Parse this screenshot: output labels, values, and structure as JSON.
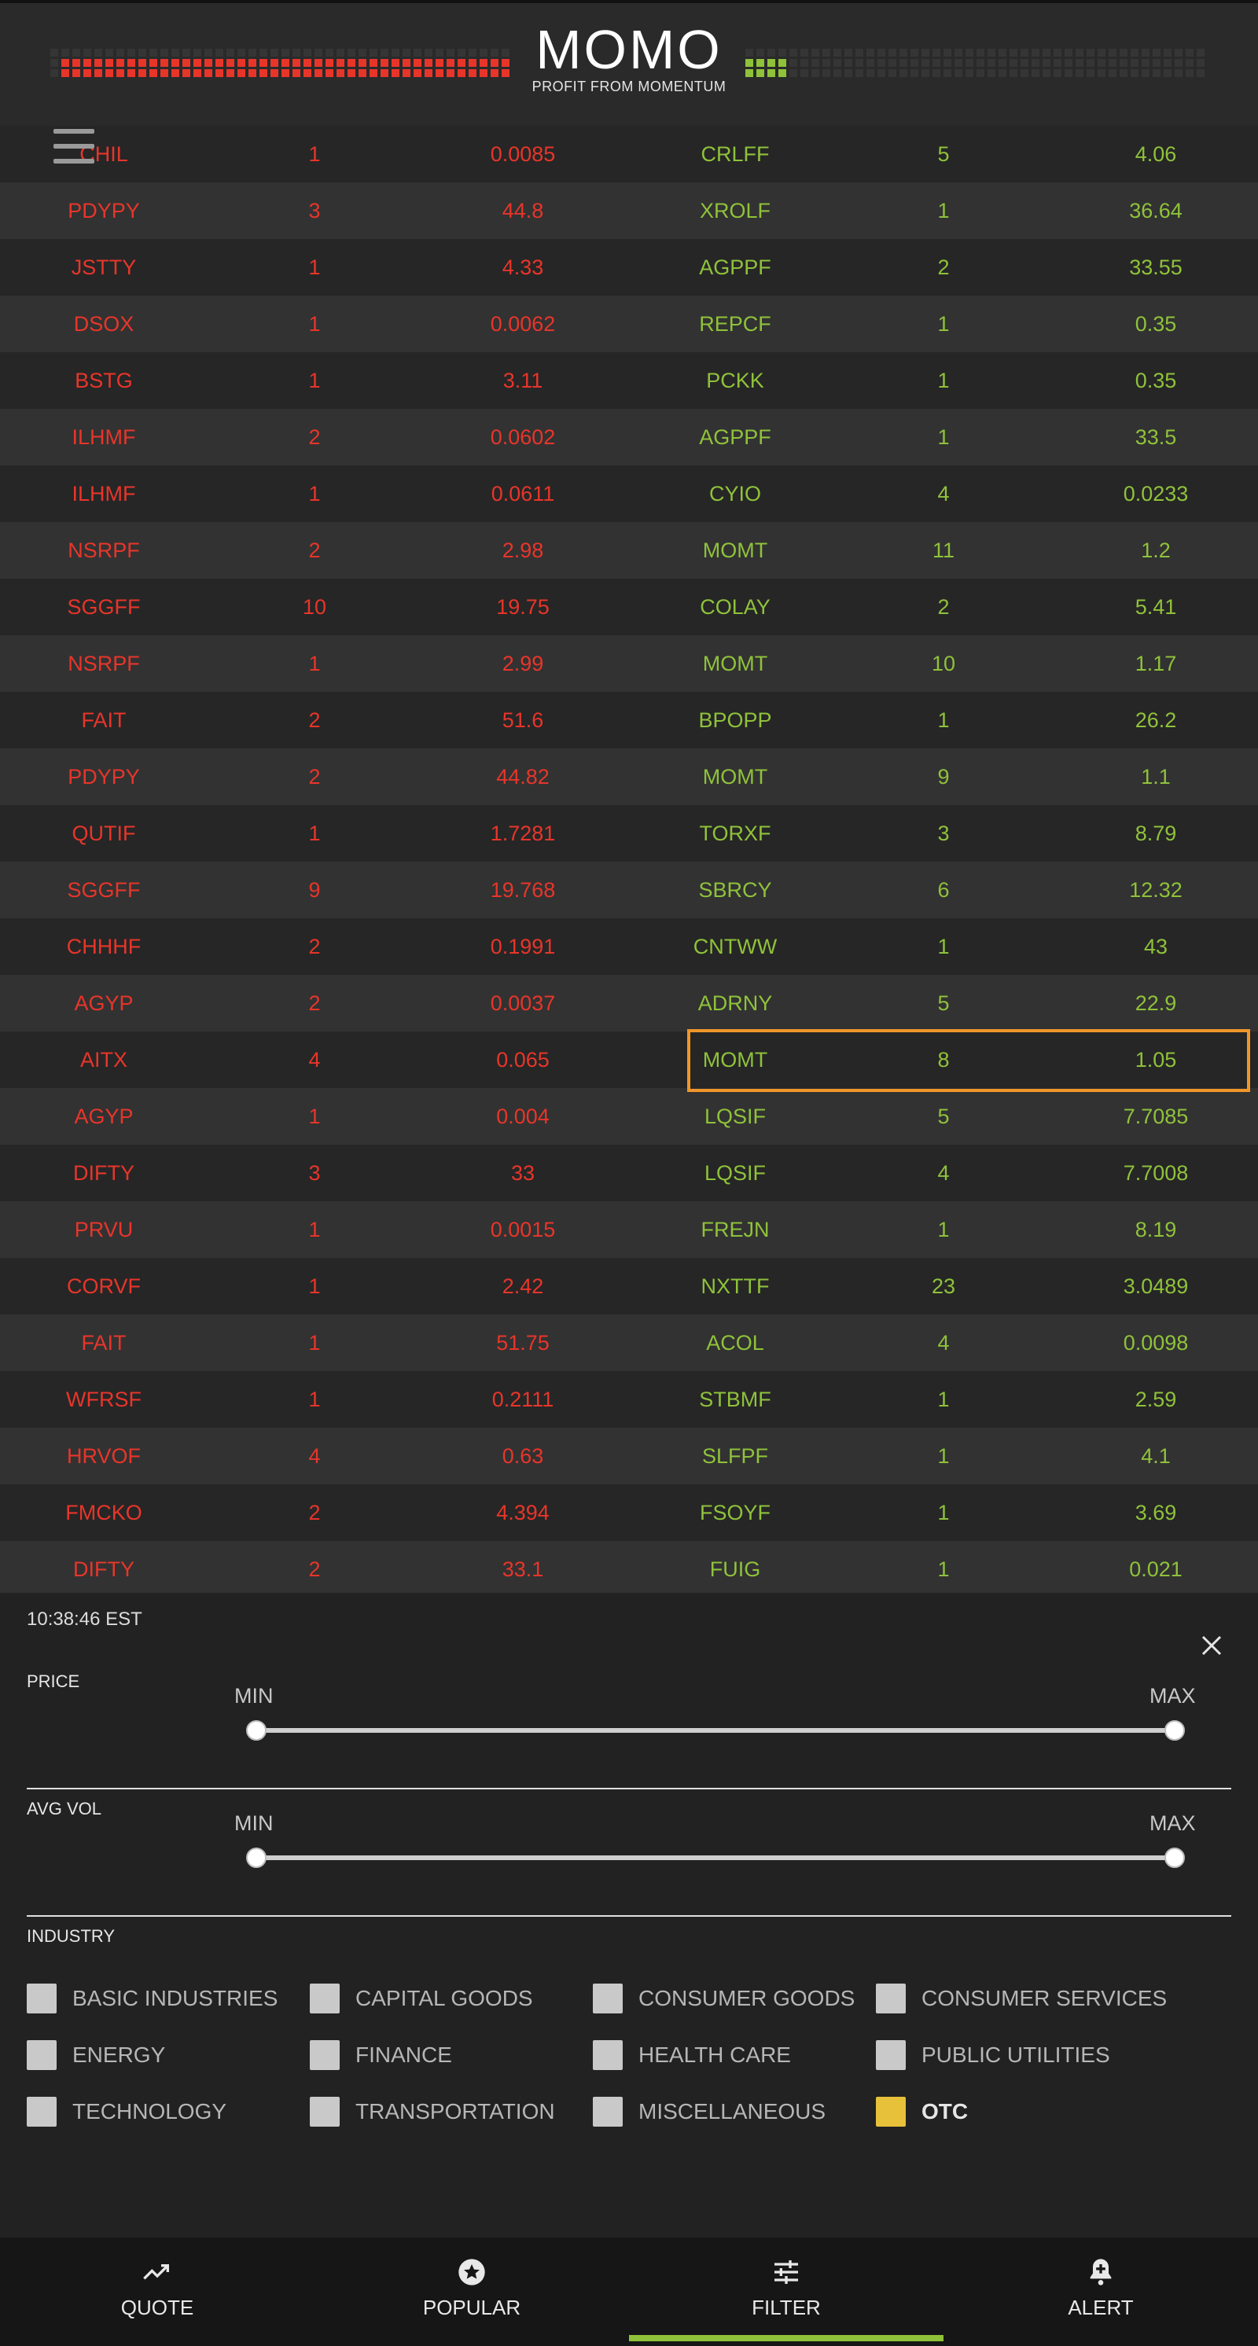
{
  "header": {
    "title": "MOMO",
    "subtitle": "PROFIT FROM MOMENTUM",
    "colors": {
      "down": "#e8352a",
      "up": "#8fc23a",
      "background": "#2a2a2a"
    }
  },
  "menu": {
    "icon": "hamburger-menu-icon"
  },
  "table": {
    "rows": [
      {
        "down_symbol": "CHIL",
        "down_count": "1",
        "down_price": "0.0085",
        "up_symbol": "CRLFF",
        "up_count": "5",
        "up_price": "4.06"
      },
      {
        "down_symbol": "PDYPY",
        "down_count": "3",
        "down_price": "44.8",
        "up_symbol": "XROLF",
        "up_count": "1",
        "up_price": "36.64"
      },
      {
        "down_symbol": "JSTTY",
        "down_count": "1",
        "down_price": "4.33",
        "up_symbol": "AGPPF",
        "up_count": "2",
        "up_price": "33.55"
      },
      {
        "down_symbol": "DSOX",
        "down_count": "1",
        "down_price": "0.0062",
        "up_symbol": "REPCF",
        "up_count": "1",
        "up_price": "0.35"
      },
      {
        "down_symbol": "BSTG",
        "down_count": "1",
        "down_price": "3.11",
        "up_symbol": "PCKK",
        "up_count": "1",
        "up_price": "0.35"
      },
      {
        "down_symbol": "ILHMF",
        "down_count": "2",
        "down_price": "0.0602",
        "up_symbol": "AGPPF",
        "up_count": "1",
        "up_price": "33.5"
      },
      {
        "down_symbol": "ILHMF",
        "down_count": "1",
        "down_price": "0.0611",
        "up_symbol": "CYIO",
        "up_count": "4",
        "up_price": "0.0233"
      },
      {
        "down_symbol": "NSRPF",
        "down_count": "2",
        "down_price": "2.98",
        "up_symbol": "MOMT",
        "up_count": "11",
        "up_price": "1.2"
      },
      {
        "down_symbol": "SGGFF",
        "down_count": "10",
        "down_price": "19.75",
        "up_symbol": "COLAY",
        "up_count": "2",
        "up_price": "5.41"
      },
      {
        "down_symbol": "NSRPF",
        "down_count": "1",
        "down_price": "2.99",
        "up_symbol": "MOMT",
        "up_count": "10",
        "up_price": "1.17"
      },
      {
        "down_symbol": "FAIT",
        "down_count": "2",
        "down_price": "51.6",
        "up_symbol": "BPOPP",
        "up_count": "1",
        "up_price": "26.2"
      },
      {
        "down_symbol": "PDYPY",
        "down_count": "2",
        "down_price": "44.82",
        "up_symbol": "MOMT",
        "up_count": "9",
        "up_price": "1.1"
      },
      {
        "down_symbol": "QUTIF",
        "down_count": "1",
        "down_price": "1.7281",
        "up_symbol": "TORXF",
        "up_count": "3",
        "up_price": "8.79"
      },
      {
        "down_symbol": "SGGFF",
        "down_count": "9",
        "down_price": "19.768",
        "up_symbol": "SBRCY",
        "up_count": "6",
        "up_price": "12.32"
      },
      {
        "down_symbol": "CHHHF",
        "down_count": "2",
        "down_price": "0.1991",
        "up_symbol": "CNTWW",
        "up_count": "1",
        "up_price": "43"
      },
      {
        "down_symbol": "AGYP",
        "down_count": "2",
        "down_price": "0.0037",
        "up_symbol": "ADRNY",
        "up_count": "5",
        "up_price": "22.9"
      },
      {
        "down_symbol": "AITX",
        "down_count": "4",
        "down_price": "0.065",
        "up_symbol": "MOMT",
        "up_count": "8",
        "up_price": "1.05"
      },
      {
        "down_symbol": "AGYP",
        "down_count": "1",
        "down_price": "0.004",
        "up_symbol": "LQSIF",
        "up_count": "5",
        "up_price": "7.7085"
      },
      {
        "down_symbol": "DIFTY",
        "down_count": "3",
        "down_price": "33",
        "up_symbol": "LQSIF",
        "up_count": "4",
        "up_price": "7.7008"
      },
      {
        "down_symbol": "PRVU",
        "down_count": "1",
        "down_price": "0.0015",
        "up_symbol": "FREJN",
        "up_count": "1",
        "up_price": "8.19"
      },
      {
        "down_symbol": "CORVF",
        "down_count": "1",
        "down_price": "2.42",
        "up_symbol": "NXTTF",
        "up_count": "23",
        "up_price": "3.0489"
      },
      {
        "down_symbol": "FAIT",
        "down_count": "1",
        "down_price": "51.75",
        "up_symbol": "ACOL",
        "up_count": "4",
        "up_price": "0.0098"
      },
      {
        "down_symbol": "WFRSF",
        "down_count": "1",
        "down_price": "0.2111",
        "up_symbol": "STBMF",
        "up_count": "1",
        "up_price": "2.59"
      },
      {
        "down_symbol": "HRVOF",
        "down_count": "4",
        "down_price": "0.63",
        "up_symbol": "SLFPF",
        "up_count": "1",
        "up_price": "4.1"
      },
      {
        "down_symbol": "FMCKO",
        "down_count": "2",
        "down_price": "4.394",
        "up_symbol": "FSOYF",
        "up_count": "1",
        "up_price": "3.69"
      },
      {
        "down_symbol": "DIFTY",
        "down_count": "2",
        "down_price": "33.1",
        "up_symbol": "FUIG",
        "up_count": "1",
        "up_price": "0.021"
      }
    ],
    "highlight_color": "#f0962a"
  },
  "filter": {
    "time": "10:38:46 EST",
    "close_icon": "close-icon",
    "price": {
      "label": "PRICE",
      "min_label": "MIN",
      "max_label": "MAX",
      "min_value": 0,
      "max_value": 1
    },
    "avg_vol": {
      "label": "AVG VOL",
      "min_label": "MIN",
      "max_label": "MAX",
      "min_value": 0,
      "max_value": 1
    },
    "industry": {
      "label": "INDUSTRY",
      "items": [
        {
          "label": "BASIC INDUSTRIES",
          "checked": false
        },
        {
          "label": "CAPITAL GOODS",
          "checked": false
        },
        {
          "label": "CONSUMER GOODS",
          "checked": false
        },
        {
          "label": "CONSUMER SERVICES",
          "checked": false
        },
        {
          "label": "ENERGY",
          "checked": false
        },
        {
          "label": "FINANCE",
          "checked": false
        },
        {
          "label": "HEALTH CARE",
          "checked": false
        },
        {
          "label": "PUBLIC UTILITIES",
          "checked": false
        },
        {
          "label": "TECHNOLOGY",
          "checked": false
        },
        {
          "label": "TRANSPORTATION",
          "checked": false
        },
        {
          "label": "MISCELLANEOUS",
          "checked": false
        },
        {
          "label": "OTC",
          "checked": true
        }
      ],
      "checked_color": "#e7c13a"
    }
  },
  "nav": {
    "items": [
      {
        "label": "QUOTE",
        "icon": "trending-up-icon"
      },
      {
        "label": "POPULAR",
        "icon": "star-circle-icon"
      },
      {
        "label": "FILTER",
        "icon": "sliders-icon"
      },
      {
        "label": "ALERT",
        "icon": "bell-plus-icon"
      }
    ],
    "active": "FILTER",
    "active_color": "#8fc23a"
  }
}
